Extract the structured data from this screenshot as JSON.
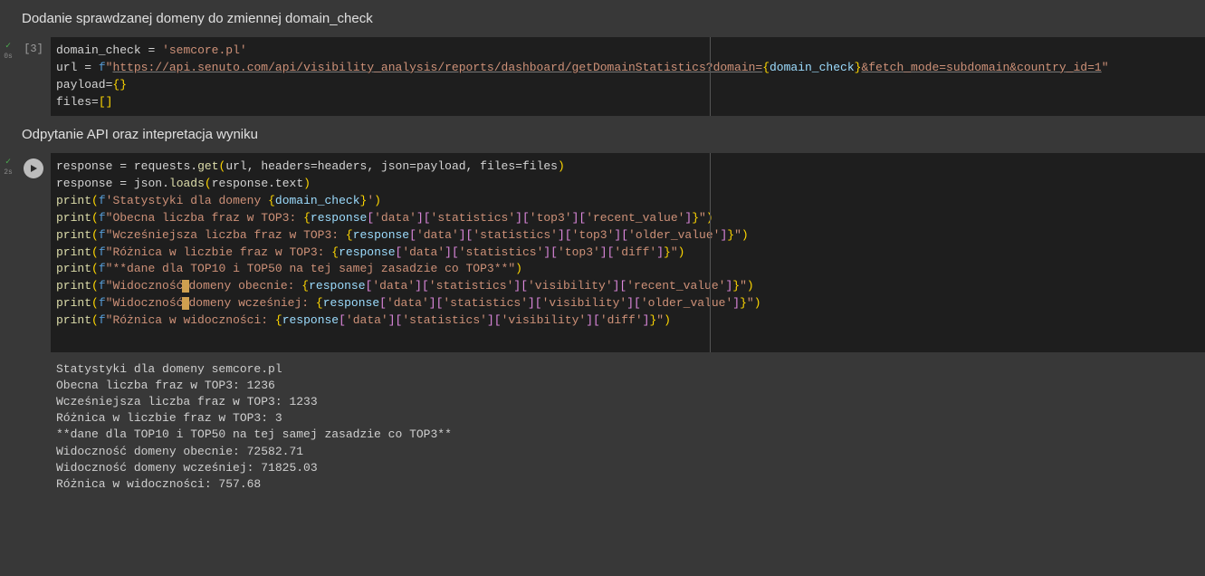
{
  "section1": {
    "heading": "Dodanie sprawdzanej domeny do zmiennej domain_check",
    "timing": "0s",
    "prompt": "[3]",
    "code": {
      "l1_var": "domain_check",
      "l1_val": "'semcore.pl'",
      "l2_var": "url",
      "l2_f": "f",
      "l2_q1": "\"",
      "l2_url": "https://api.senuto.com/api/visibility_analysis/reports/dashboard/getDomainStatistics?domain=",
      "l2_expr": "domain_check",
      "l2_tail": "&fetch_mode=subdomain&country_id=1",
      "l2_q2": "\"",
      "l3_var": "payload",
      "l4_var": "files"
    }
  },
  "section2": {
    "heading": "Odpytanie API oraz intepretacja wyniku",
    "timing": "2s",
    "output": "Statystyki dla domeny semcore.pl\nObecna liczba fraz w TOP3: 1236\nWcześniejsza liczba fraz w TOP3: 1233\nRóżnica w liczbie fraz w TOP3: 3\n**dane dla TOP10 i TOP50 na tej samej zasadzie co TOP3**\nWidoczność domeny obecnie: 72582.71\nWidoczność domeny wcześniej: 71825.03\nRóżnica w widoczności: 757.68",
    "code": {
      "l1_a": "response",
      "l1_b": "requests",
      "l1_c": "get",
      "l1_args": "url, headers=headers, json=payload, files=files",
      "l2_a": "response",
      "l2_b": "json",
      "l2_c": "loads",
      "l2_in": "response.text",
      "p1_pre": "'Statystyki dla domeny ",
      "p1_expr": "domain_check",
      "p1_post": "'",
      "p2_str": "\"Obecna liczba fraz w TOP3: ",
      "p2_expr": "response",
      "p2_k1": "'data'",
      "p2_k2": "'statistics'",
      "p2_k3": "'top3'",
      "p2_k4": "'recent_value'",
      "p3_str": "\"Wcześniejsza liczba fraz w TOP3: ",
      "p3_k4": "'older_value'",
      "p4_str": "\"Różnica w liczbie fraz w TOP3: ",
      "p4_k4": "'diff'",
      "p5_str": "\"**dane dla TOP10 i TOP50 na tej samej zasadzie co TOP3**\"",
      "p6_str": "\"Widoczność",
      "p6_str2": "domeny obecnie: ",
      "p6_k3": "'visibility'",
      "p6_k4": "'recent_value'",
      "p7_str": "\"Widoczność",
      "p7_str2": "domeny wcześniej: ",
      "p7_k4": "'older_value'",
      "p8_str": "\"Różnica w widoczności: ",
      "p8_k4": "'diff'",
      "print": "print",
      "f": "f"
    }
  }
}
